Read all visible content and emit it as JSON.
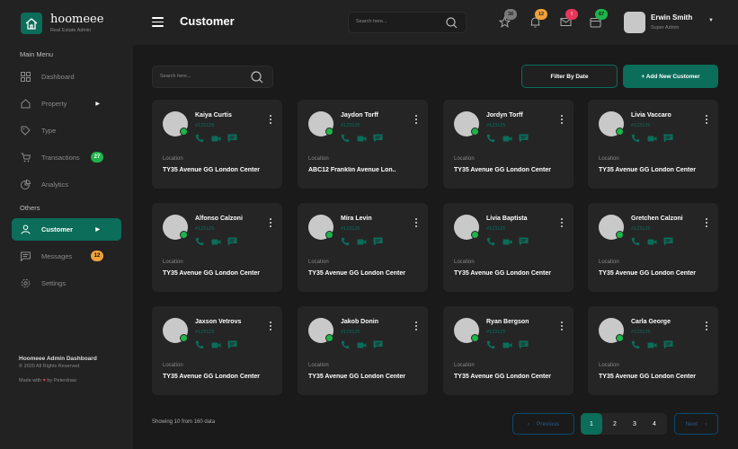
{
  "brand": {
    "name": "hoomeee",
    "subtitle": "Real Estate Admin"
  },
  "sidebar": {
    "section_main": "Main Menu",
    "section_others": "Others",
    "items": [
      {
        "label": "Dashboard",
        "icon": "grid-icon"
      },
      {
        "label": "Property",
        "icon": "home-icon"
      },
      {
        "label": "Type",
        "icon": "tag-icon"
      },
      {
        "label": "Transactions",
        "icon": "cart-icon",
        "badge": "27"
      },
      {
        "label": "Analytics",
        "icon": "pie-chart-icon"
      },
      {
        "label": "Customer",
        "icon": "user-icon"
      },
      {
        "label": "Messages",
        "icon": "message-icon",
        "badge": "12"
      },
      {
        "label": "Settings",
        "icon": "gear-icon"
      }
    ],
    "footer": {
      "title": "Hoomeee Admin Dashboard",
      "copyright": "© 2020 All Rights Reserved",
      "made_with_prefix": "Made with",
      "made_with_suffix": "by Peterdraw"
    }
  },
  "topbar": {
    "title": "Customer",
    "search_placeholder": "Search here...",
    "notifications": [
      {
        "icon": "star-icon",
        "count": "38",
        "color": "#7a7a7a"
      },
      {
        "icon": "bell-icon",
        "count": "12",
        "color": "#f0a13a"
      },
      {
        "icon": "mail-icon",
        "count": "!",
        "color": "#e8365a"
      },
      {
        "icon": "calendar-icon",
        "count": "67",
        "color": "#1db44a"
      }
    ],
    "user": {
      "name": "Erwin Smith",
      "role": "Super Admin"
    }
  },
  "main": {
    "search_placeholder": "Search here...",
    "filter_label": "Filter By Date",
    "add_label": "+ Add New Customer",
    "location_label": "Location",
    "customers": [
      {
        "name": "Kaiya Curtis",
        "id": "#123125",
        "location": "TY35 Avenue GG London Center"
      },
      {
        "name": "Jaydon Torff",
        "id": "#123125",
        "location": "ABC12 Franklin Avenue Lon.."
      },
      {
        "name": "Jordyn Torff",
        "id": "#123125",
        "location": "TY35 Avenue GG London Center"
      },
      {
        "name": "Livia Vaccaro",
        "id": "#123125",
        "location": "TY35 Avenue GG London Center"
      },
      {
        "name": "Alfonso Calzoni",
        "id": "#123125",
        "location": "TY35 Avenue GG London Center"
      },
      {
        "name": "Mira Levin",
        "id": "#123125",
        "location": "TY35 Avenue GG London Center"
      },
      {
        "name": "Livia Baptista",
        "id": "#123125",
        "location": "TY35 Avenue GG London Center"
      },
      {
        "name": "Gretchen Calzoni",
        "id": "#123125",
        "location": "TY35 Avenue GG London Center"
      },
      {
        "name": "Jaxson Vetrovs",
        "id": "#123125",
        "location": "TY35 Avenue GG London Center"
      },
      {
        "name": "Jakob Donin",
        "id": "#123125",
        "location": "TY35 Avenue GG London Center"
      },
      {
        "name": "Ryan Bergson",
        "id": "#123125",
        "location": "TY35 Avenue GG London Center"
      },
      {
        "name": "Carla George",
        "id": "#123125",
        "location": "TY35 Avenue GG London Center"
      }
    ],
    "showing_text": "Showing 10 from 160 data",
    "pagination": {
      "prev": "Previous",
      "next": "Next",
      "pages": [
        "1",
        "2",
        "3",
        "4"
      ],
      "current": "1"
    }
  },
  "colors": {
    "accent": "#0b6d5a",
    "online": "#1db44a",
    "heart": "#e8365a"
  }
}
